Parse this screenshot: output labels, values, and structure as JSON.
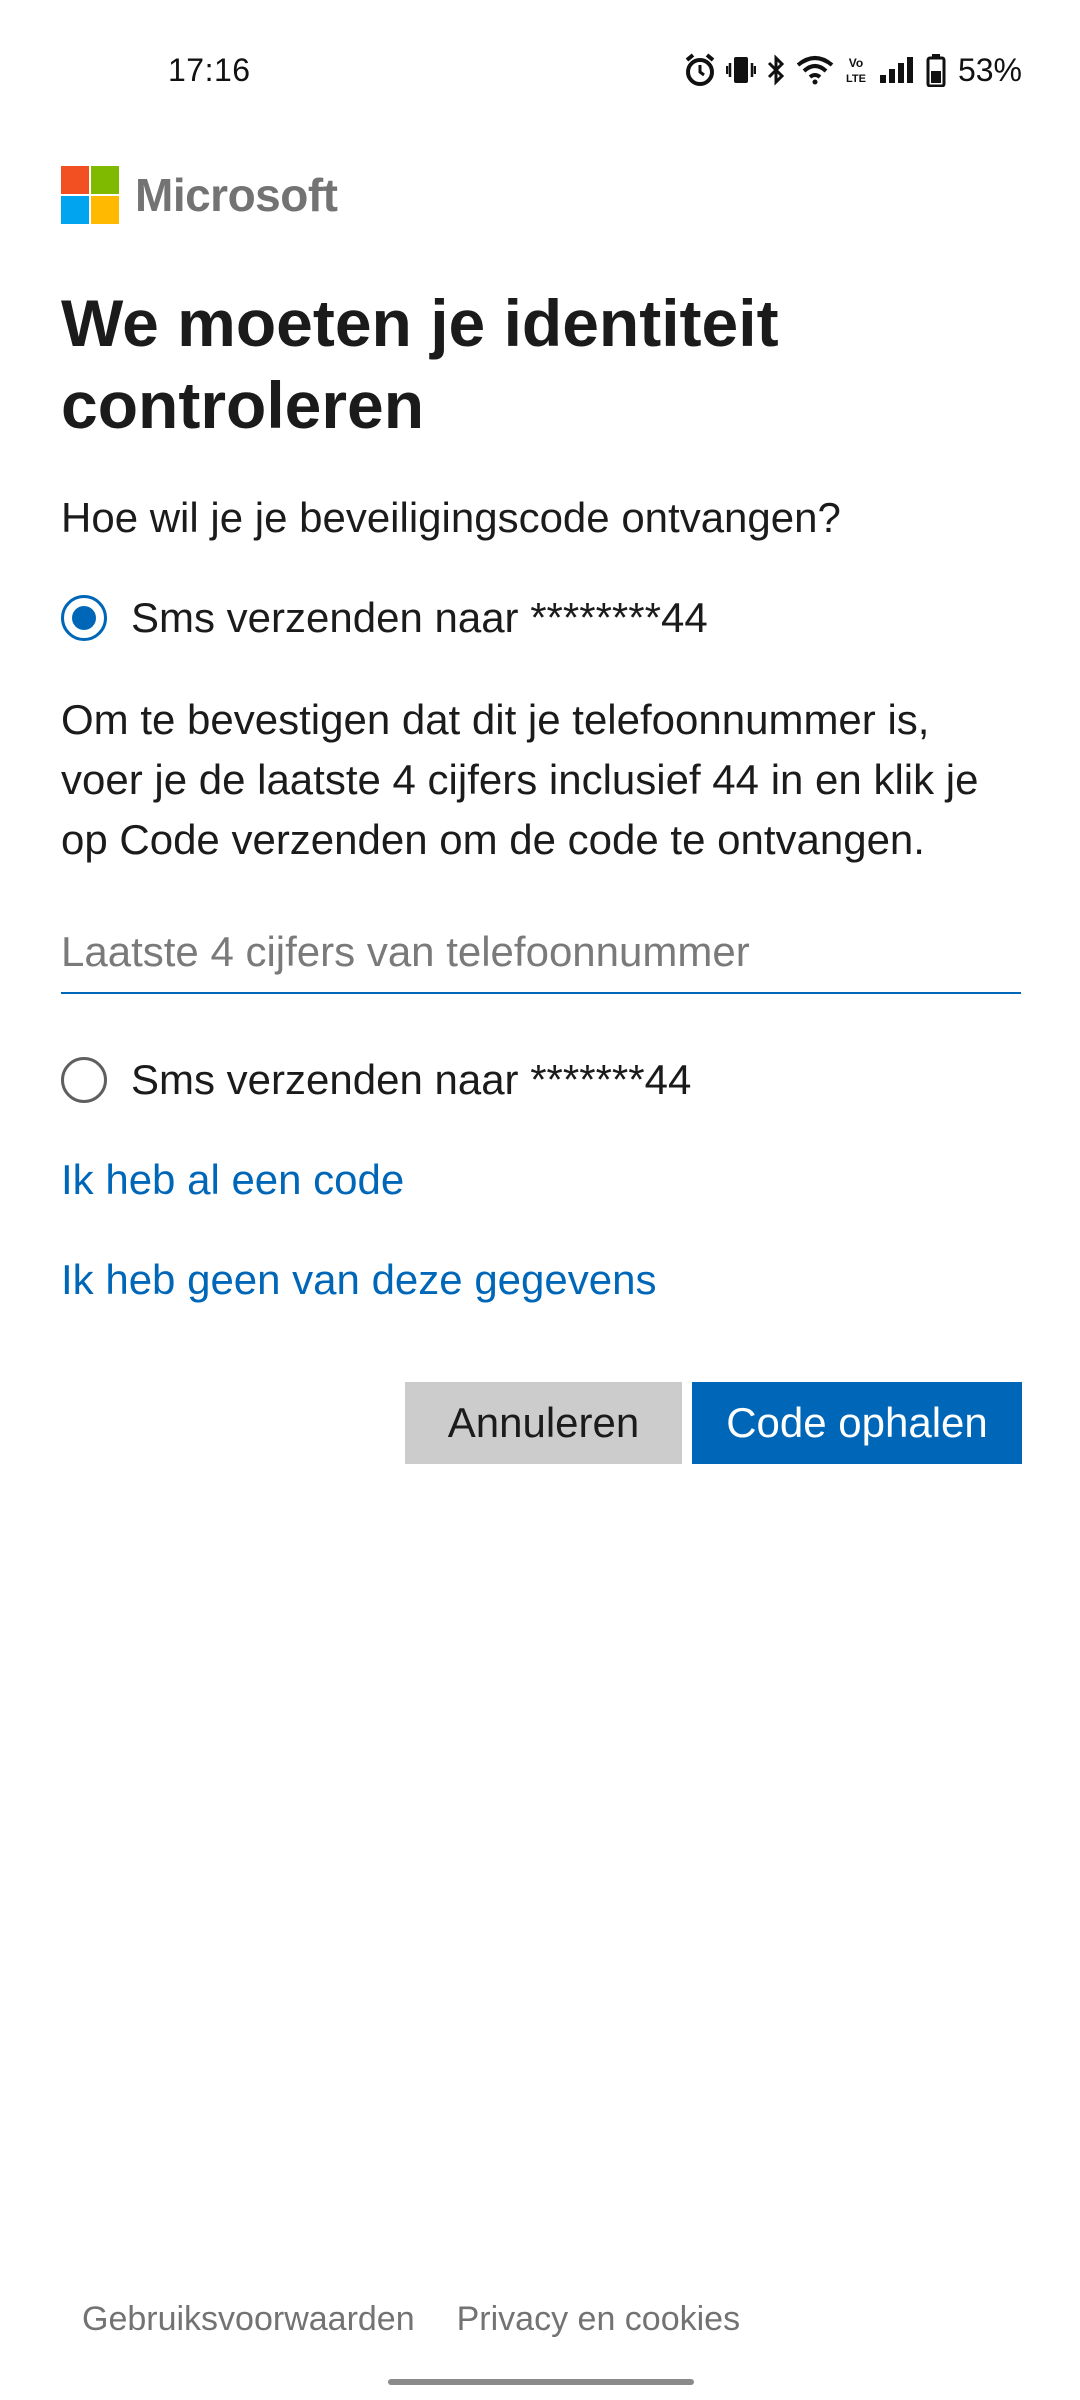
{
  "status_bar": {
    "time": "17:16",
    "battery": "53%",
    "icons": [
      "alarm-icon",
      "vibrate-icon",
      "bluetooth-icon",
      "wifi-icon",
      "volte-icon",
      "signal-icon",
      "battery-icon"
    ]
  },
  "logo": {
    "text": "Microsoft",
    "colors": [
      "#f25022",
      "#7fba00",
      "#00a4ef",
      "#ffb900"
    ]
  },
  "page": {
    "title": "We moeten je identiteit controleren",
    "subtitle": "Hoe wil je je beveiligingscode ontvangen?"
  },
  "options": [
    {
      "label": "Sms verzenden naar ********44",
      "selected": true
    },
    {
      "label": "Sms verzenden naar *******44",
      "selected": false
    }
  ],
  "description": "Om te bevestigen dat dit je telefoonnummer is, voer je de laatste 4 cijfers inclusief 44 in en klik je op Code verzenden om de code te ontvangen.",
  "phone_input": {
    "placeholder": "Laatste 4 cijfers van telefoonnummer",
    "value": ""
  },
  "links": {
    "have_code": "Ik heb al een code",
    "none_of_these": "Ik heb geen van deze gegevens"
  },
  "buttons": {
    "cancel": "Annuleren",
    "get_code": "Code ophalen"
  },
  "footer": {
    "terms": "Gebruiksvoorwaarden",
    "privacy": "Privacy en cookies"
  },
  "colors": {
    "accent": "#0067b8",
    "cancel_bg": "#cccccc",
    "muted_text": "#737373"
  }
}
